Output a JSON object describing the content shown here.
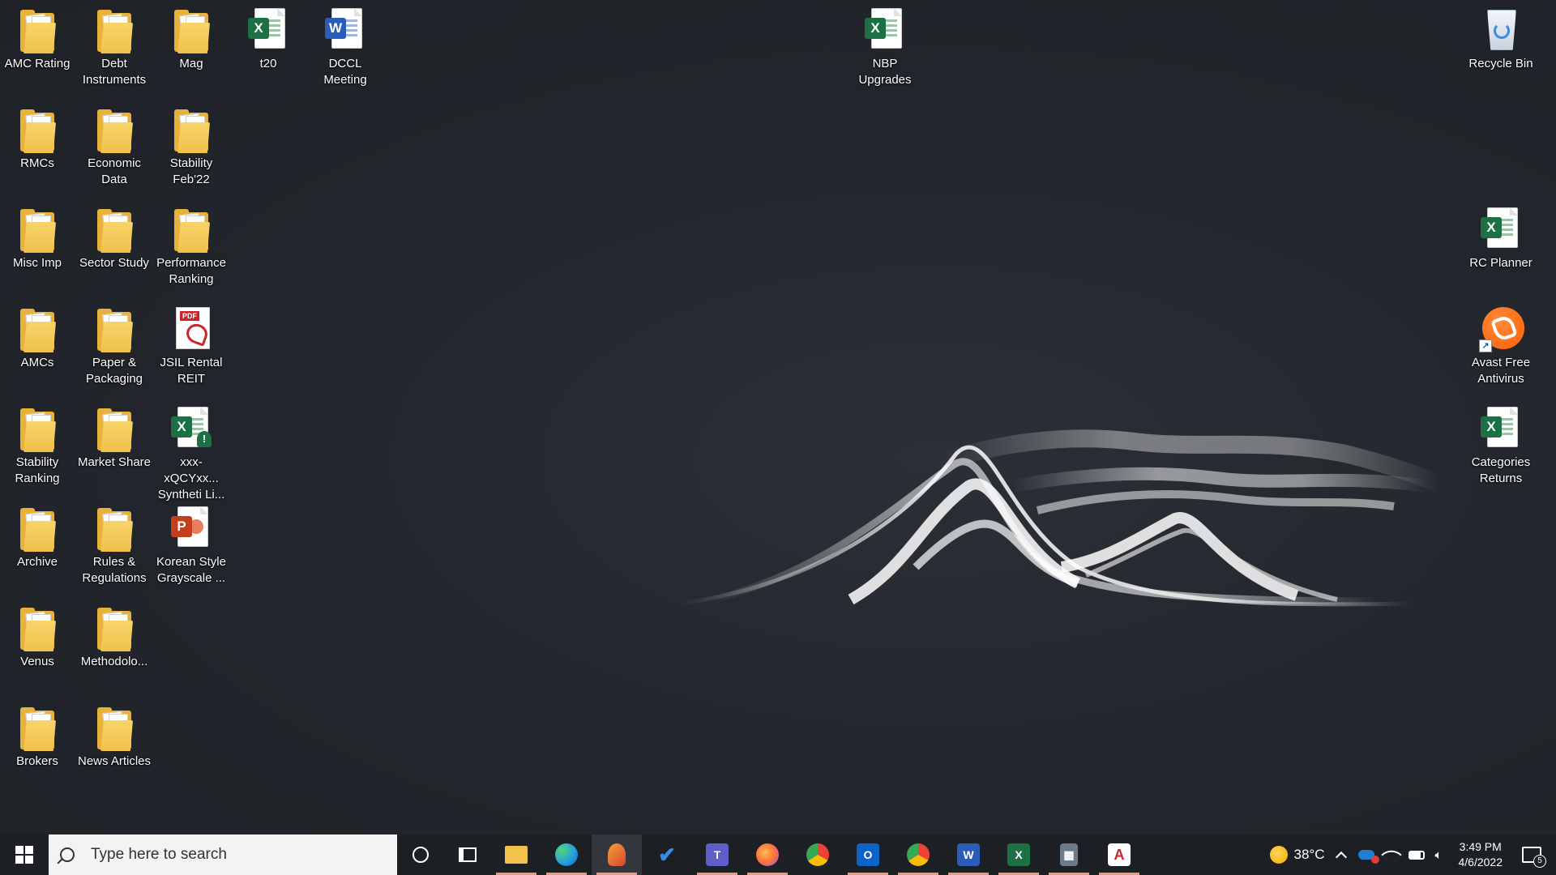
{
  "desktop": {
    "icons": [
      {
        "id": "amc-rating",
        "label": "AMC Rating",
        "type": "folder",
        "mark": "x"
      },
      {
        "id": "debt-instruments",
        "label": "Debt Instruments",
        "type": "folder",
        "mark": "none"
      },
      {
        "id": "mag",
        "label": "Mag",
        "type": "folder",
        "mark": "pdf"
      },
      {
        "id": "t20",
        "label": "t20",
        "type": "excel"
      },
      {
        "id": "dccl-meeting",
        "label": "DCCL Meeting",
        "type": "word"
      },
      {
        "id": "nbp-upgrades",
        "label": "NBP Upgrades",
        "type": "excel"
      },
      {
        "id": "recycle-bin",
        "label": "Recycle Bin",
        "type": "recycle-bin"
      },
      {
        "id": "rmcs",
        "label": "RMCs",
        "type": "folder",
        "mark": "x"
      },
      {
        "id": "economic-data",
        "label": "Economic Data",
        "type": "folder",
        "mark": "x"
      },
      {
        "id": "stability-feb22",
        "label": "Stability Feb'22",
        "type": "folder",
        "mark": "x"
      },
      {
        "id": "misc-imp",
        "label": "Misc Imp",
        "type": "folder",
        "mark": "w"
      },
      {
        "id": "sector-study",
        "label": "Sector Study",
        "type": "folder",
        "mark": "pdf"
      },
      {
        "id": "performance-ranking",
        "label": "Performance Ranking",
        "type": "folder",
        "mark": "none"
      },
      {
        "id": "rc-planner",
        "label": "RC Planner",
        "type": "excel"
      },
      {
        "id": "amcs",
        "label": "AMCs",
        "type": "folder",
        "mark": "x"
      },
      {
        "id": "paper-packaging",
        "label": "Paper & Packaging",
        "type": "folder",
        "mark": "x"
      },
      {
        "id": "jsil-rental-reit",
        "label": "JSIL Rental REIT",
        "type": "pdf"
      },
      {
        "id": "avast",
        "label": "Avast Free Antivirus",
        "type": "avast"
      },
      {
        "id": "stability-ranking",
        "label": "Stability Ranking",
        "type": "folder",
        "mark": "x"
      },
      {
        "id": "market-share",
        "label": "Market Share",
        "type": "folder",
        "mark": "x"
      },
      {
        "id": "synthetic-file",
        "label": "xxx-xQCYxx... Syntheti Li...",
        "type": "excel-warn"
      },
      {
        "id": "categories-returns",
        "label": "Categories Returns",
        "type": "excel"
      },
      {
        "id": "archive",
        "label": "Archive",
        "type": "folder",
        "mark": "x"
      },
      {
        "id": "rules-regulations",
        "label": "Rules & Regulations",
        "type": "folder",
        "mark": "pdf"
      },
      {
        "id": "korean-style",
        "label": "Korean Style Grayscale ...",
        "type": "powerpoint"
      },
      {
        "id": "venus",
        "label": "Venus",
        "type": "folder",
        "mark": "x"
      },
      {
        "id": "methodology",
        "label": "Methodolo...",
        "type": "folder",
        "mark": "pdf"
      },
      {
        "id": "brokers",
        "label": "Brokers",
        "type": "folder",
        "mark": "none"
      },
      {
        "id": "news-articles",
        "label": "News Articles",
        "type": "folder",
        "mark": "pdf"
      }
    ]
  },
  "taskbar": {
    "search_placeholder": "Type here to search",
    "apps": [
      {
        "id": "cortana",
        "icon": "cortana-icon"
      },
      {
        "id": "task-view",
        "icon": "task-view-icon"
      },
      {
        "id": "file-explorer",
        "icon": "file-explorer-icon",
        "color": "#f0c14b",
        "running": true
      },
      {
        "id": "edge",
        "icon": "edge-icon",
        "color": "#1f9ce0",
        "running": true
      },
      {
        "id": "snip-sketch",
        "icon": "snip-sketch-icon",
        "color": "#d8452e",
        "running": true,
        "active": true
      },
      {
        "id": "todo",
        "icon": "todo-icon",
        "color": "#3c8ae8"
      },
      {
        "id": "teams",
        "icon": "teams-icon",
        "color": "#5b5fc7",
        "running": true
      },
      {
        "id": "firefox",
        "icon": "firefox-icon",
        "color": "#ff7139",
        "running": true
      },
      {
        "id": "chrome",
        "icon": "chrome-icon",
        "color": "#34a853"
      },
      {
        "id": "outlook",
        "icon": "outlook-icon",
        "color": "#0a64c8",
        "running": true
      },
      {
        "id": "chrome-profile",
        "icon": "chrome-icon",
        "color": "#34a853",
        "running": true
      },
      {
        "id": "word",
        "icon": "word-icon",
        "color": "#2b5cb8",
        "running": true
      },
      {
        "id": "excel",
        "icon": "excel-icon",
        "color": "#1d7044",
        "running": true
      },
      {
        "id": "calculator",
        "icon": "calculator-icon",
        "color": "#6c7a89",
        "running": true
      },
      {
        "id": "acrobat",
        "icon": "acrobat-icon",
        "color": "#c8262c",
        "running": true
      }
    ],
    "tray": {
      "temperature": "38°C",
      "time": "3:49 PM",
      "date": "4/6/2022",
      "notification_count": "5"
    }
  }
}
